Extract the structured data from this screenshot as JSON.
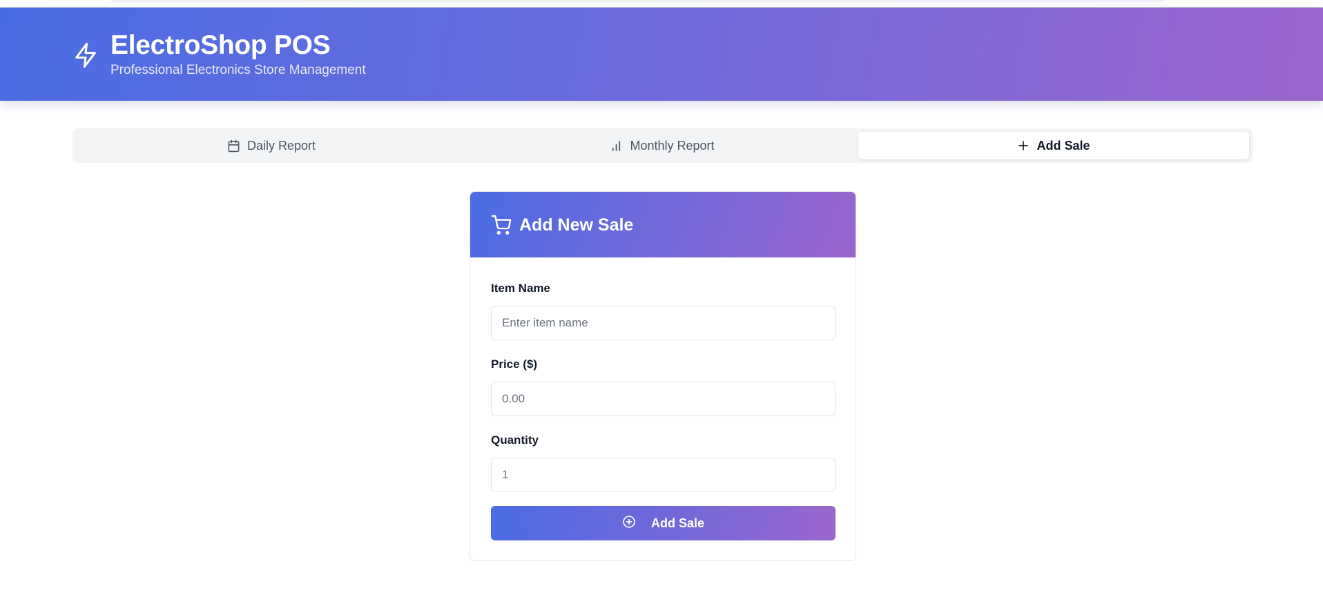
{
  "app": {
    "title": "ElectroShop POS",
    "subtitle": "Professional Electronics Store Management",
    "logo_icon": "lightning-bolt-icon"
  },
  "tabs": [
    {
      "label": "Daily Report",
      "icon": "calendar-icon",
      "active": false
    },
    {
      "label": "Monthly Report",
      "icon": "bar-chart-icon",
      "active": false
    },
    {
      "label": "Add Sale",
      "icon": "plus-icon",
      "active": true
    }
  ],
  "form": {
    "title": "Add New Sale",
    "title_icon": "shopping-cart-icon",
    "item_name": {
      "label": "Item Name",
      "placeholder": "Enter item name",
      "value": ""
    },
    "price": {
      "label": "Price ($)",
      "placeholder": "0.00",
      "value": ""
    },
    "quantity": {
      "label": "Quantity",
      "placeholder": "1",
      "value": ""
    },
    "submit_label": "Add Sale",
    "submit_icon": "plus-circle-icon"
  },
  "colors": {
    "gradient_start": "#4a6ce3",
    "gradient_end": "#9a66cc",
    "tab_bar_bg": "#f2f4f6",
    "active_tab_bg": "#ffffff"
  }
}
